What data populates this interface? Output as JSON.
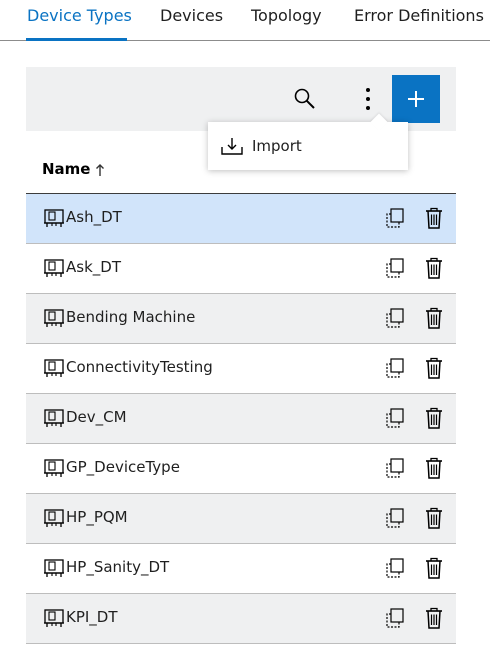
{
  "tabs": [
    {
      "label": "Device Types",
      "active": true
    },
    {
      "label": "Devices",
      "active": false
    },
    {
      "label": "Topology",
      "active": false
    },
    {
      "label": "Error Definitions",
      "active": false
    }
  ],
  "toolbar": {
    "search_icon": "search-icon",
    "more_icon": "more-vertical-icon",
    "add_icon": "plus-icon"
  },
  "menu": {
    "items": [
      {
        "label": "Import",
        "icon": "import-icon"
      }
    ]
  },
  "table": {
    "column_name": "Name",
    "sort": "ascending",
    "rows": [
      {
        "name": "Ash_DT",
        "selected": true
      },
      {
        "name": "Ask_DT",
        "selected": false
      },
      {
        "name": "Bending Machine",
        "selected": false
      },
      {
        "name": "ConnectivityTesting",
        "selected": false
      },
      {
        "name": "Dev_CM",
        "selected": false
      },
      {
        "name": "GP_DeviceType",
        "selected": false
      },
      {
        "name": "HP_PQM",
        "selected": false
      },
      {
        "name": "HP_Sanity_DT",
        "selected": false
      },
      {
        "name": "KPI_DT",
        "selected": false
      }
    ]
  },
  "colors": {
    "accent": "#0a73c3",
    "selected_row": "#d1e4fa",
    "toolbar_bg": "#eff0f1"
  }
}
